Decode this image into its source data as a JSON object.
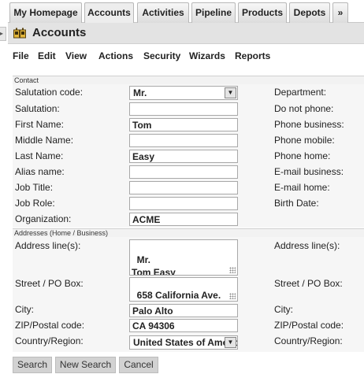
{
  "tabs": [
    "My Homepage",
    "Accounts",
    "Activities",
    "Pipeline",
    "Products",
    "Depots",
    "»"
  ],
  "header": {
    "title": "Accounts",
    "icon": "accounts-icon"
  },
  "menu": [
    "File",
    "Edit",
    "View",
    "Actions",
    "Security",
    "Wizards",
    "Reports"
  ],
  "contact": {
    "section_title": "Contact",
    "left_labels": [
      "Salutation code:",
      "Salutation:",
      "First Name:",
      "Middle Name:",
      "Last Name:",
      "Alias name:",
      "Job Title:",
      "Job Role:",
      "Organization:"
    ],
    "right_labels": [
      "Department:",
      "Do not phone:",
      "Phone business:",
      "Phone mobile:",
      "Phone home:",
      "E-mail business:",
      "E-mail home:",
      "Birth Date:"
    ],
    "salutation_code": "Mr.",
    "salutation": "",
    "first_name": "Tom",
    "middle_name": "",
    "last_name": "Easy",
    "alias_name": "",
    "job_title": "",
    "job_role": "",
    "organization": "ACME"
  },
  "addresses": {
    "section_title": "Addresses (Home / Business)",
    "left_labels": [
      "Address line(s):",
      "Street / PO Box:",
      "City:",
      "ZIP/Postal code:",
      "Country/Region:"
    ],
    "right_labels": [
      "Address line(s):",
      "Street / PO Box:",
      "City:",
      "ZIP/Postal code:",
      "Country/Region:"
    ],
    "address_lines": "Mr.\nTom Easy",
    "street": "658 California Ave.",
    "city": "Palo Alto",
    "zip": "CA 94306",
    "country": "United States of America"
  },
  "buttons": {
    "search": "Search",
    "new_search": "New Search",
    "cancel": "Cancel"
  }
}
